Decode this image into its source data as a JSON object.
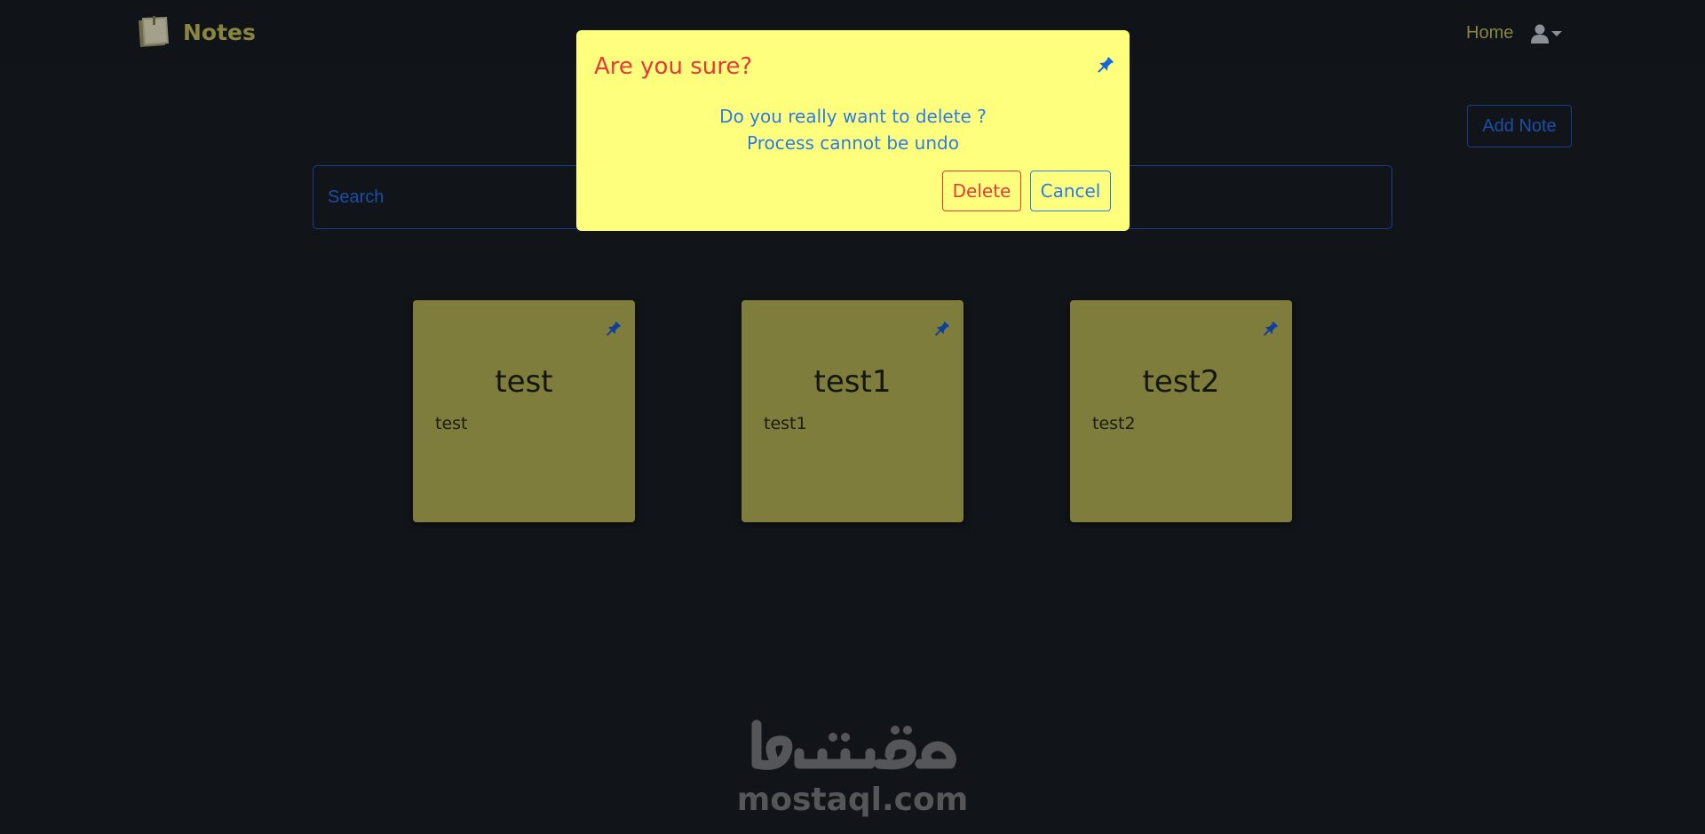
{
  "navbar": {
    "brand": "Notes",
    "home": "Home"
  },
  "toolbar": {
    "add_note": "Add Note"
  },
  "search": {
    "placeholder": "Search"
  },
  "notes": [
    {
      "title": "test",
      "body": "test"
    },
    {
      "title": "test1",
      "body": "test1"
    },
    {
      "title": "test2",
      "body": "test2"
    }
  ],
  "modal": {
    "title": "Are you sure?",
    "message_line1": "Do you really want to delete ?",
    "message_line2": "Process cannot be undo",
    "delete": "Delete",
    "cancel": "Cancel"
  },
  "watermark": {
    "latin": "mostaql.com",
    "arabic": "مستقل"
  },
  "colors": {
    "background": "#111418",
    "note": "#7f7d3b",
    "modal": "#ffff7e",
    "danger": "#e63a3a",
    "primary": "#2d7be6",
    "brand": "#8a8640"
  },
  "icons": {
    "brand": "notebook-icon",
    "user": "user-icon",
    "pin": "pin-icon"
  }
}
